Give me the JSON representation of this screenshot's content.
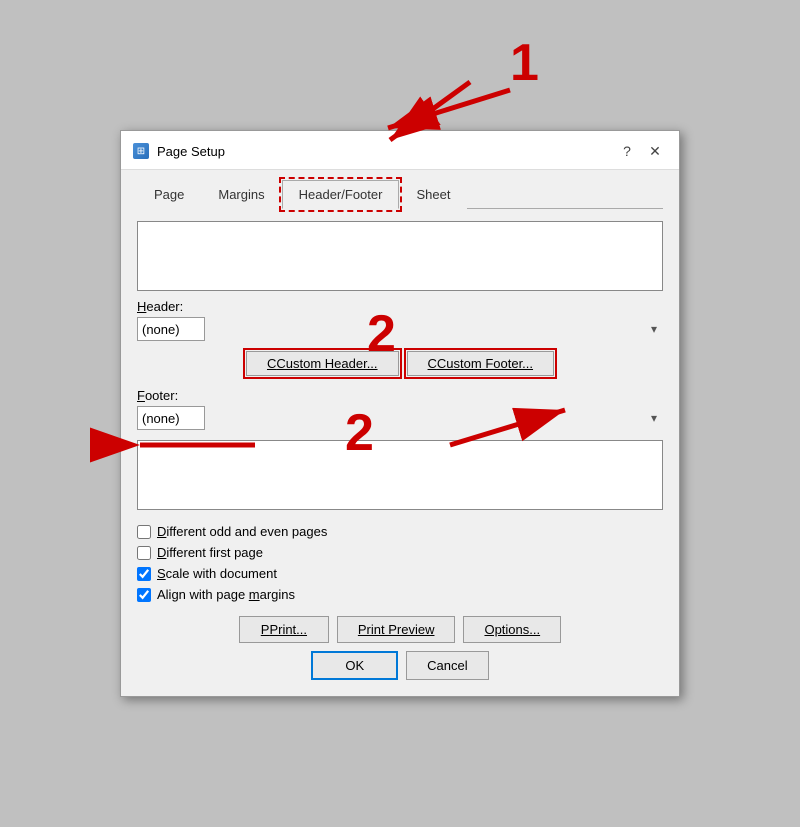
{
  "dialog": {
    "title": "Page Setup",
    "icon": "⊞",
    "help_button": "?",
    "close_button": "✕"
  },
  "tabs": [
    {
      "id": "page",
      "label": "Page",
      "active": false,
      "highlighted": false
    },
    {
      "id": "margins",
      "label": "Margins",
      "active": false,
      "highlighted": false
    },
    {
      "id": "header_footer",
      "label": "Header/Footer",
      "active": true,
      "highlighted": true
    },
    {
      "id": "sheet",
      "label": "Sheet",
      "active": false,
      "highlighted": false
    }
  ],
  "header_section": {
    "label": "Header:",
    "value": "(none)",
    "custom_header_btn": "Custom Header...",
    "custom_footer_btn": "Custom Footer..."
  },
  "footer_section": {
    "label": "Footer:",
    "value": "(none)"
  },
  "checkboxes": [
    {
      "id": "diff_odd_even",
      "label_prefix": "Different odd and even pages",
      "underline_char": "D",
      "checked": false
    },
    {
      "id": "diff_first",
      "label_prefix": "Different first page",
      "underline_char": "D",
      "checked": false
    },
    {
      "id": "scale_doc",
      "label_prefix": "Scale with document",
      "underline_char": "S",
      "checked": true
    },
    {
      "id": "align_margins",
      "label_prefix": "Align with page margins",
      "underline_char": "m",
      "checked": true
    }
  ],
  "bottom_buttons": {
    "print": "Print...",
    "print_preview": "Print Preview",
    "options": "Options..."
  },
  "ok_cancel": {
    "ok": "OK",
    "cancel": "Cancel"
  },
  "annotations": {
    "number1": "1",
    "number2": "2"
  }
}
